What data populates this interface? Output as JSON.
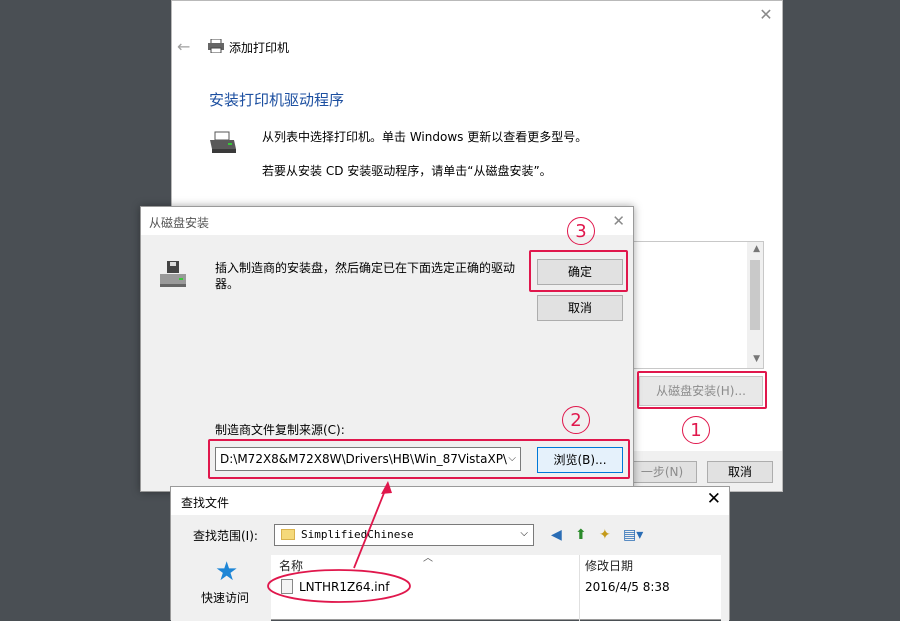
{
  "wizard": {
    "title": "添加打印机",
    "heading": "安装打印机驱动程序",
    "desc1": "从列表中选择打印机。单击 Windows 更新以查看更多型号。",
    "desc2": "若要从安装 CD 安装驱动程序，请单击“从磁盘安装”。",
    "disk_button": "从磁盘安装(H)...",
    "next_button": "一步(N)",
    "cancel_button": "取消"
  },
  "disk_dialog": {
    "title": "从磁盘安装",
    "message": "插入制造商的安装盘，然后确定已在下面选定正确的驱动器。",
    "ok_button": "确定",
    "cancel_button": "取消",
    "source_label": "制造商文件复制来源(C):",
    "source_value": "D:\\M72X8&M72X8W\\Drivers\\HB\\Win_87VistaXP\\",
    "browse_button": "浏览(B)..."
  },
  "find_dialog": {
    "title": "查找文件",
    "look_in_label": "查找范围(I):",
    "look_in_value": "SimplifiedChinese",
    "places_recent": "快速访问",
    "col_name": "名称",
    "col_date": "修改日期",
    "file_name": "LNTHR1Z64.inf",
    "file_date": "2016/4/5 8:38"
  },
  "annotations": {
    "step1": "1",
    "step2": "2",
    "step3": "3"
  },
  "colors": {
    "annotation": "#e0174c",
    "heading": "#1c4fa0",
    "focus": "#0078d7"
  }
}
